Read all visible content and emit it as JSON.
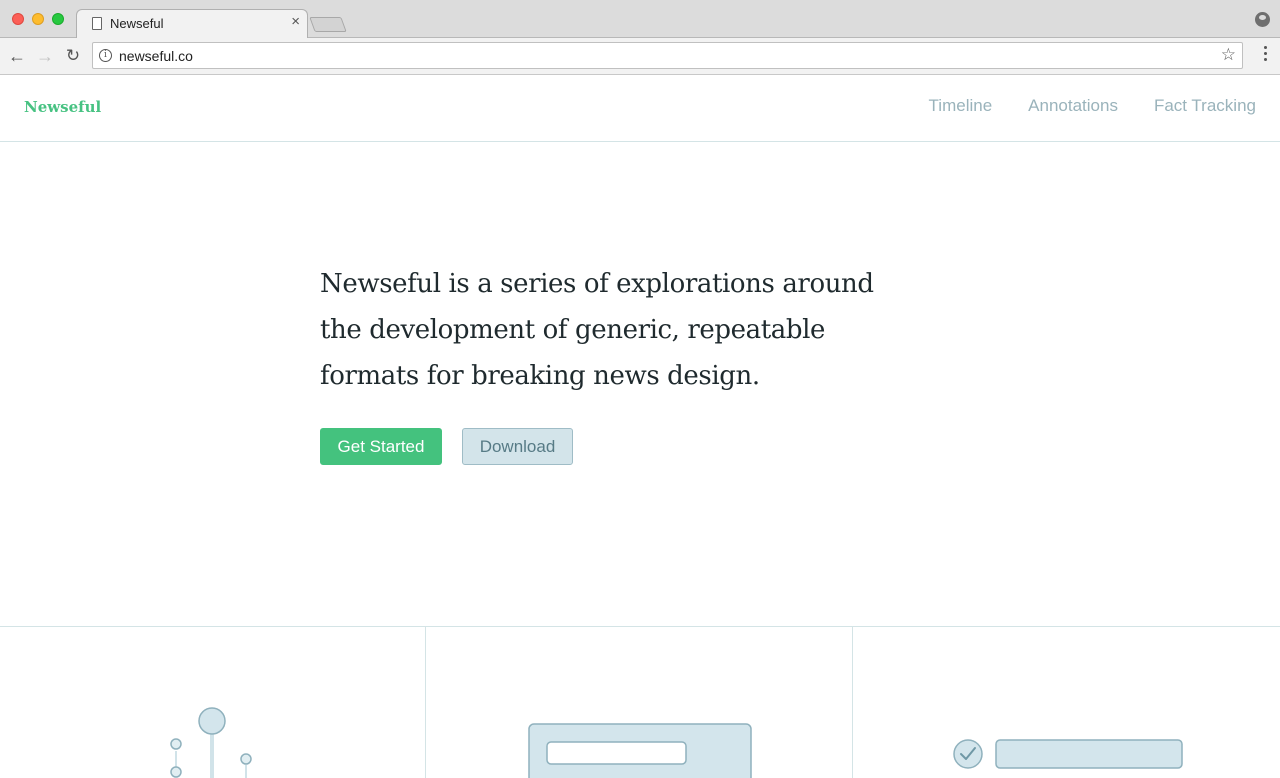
{
  "browser": {
    "tab_title": "Newseful",
    "tab_close": "×",
    "url": "newseful.co",
    "back_glyph": "←",
    "forward_glyph": "→",
    "reload_glyph": "↻",
    "info_glyph": "i",
    "star_glyph": "☆",
    "icons": [
      "page-icon",
      "close-icon",
      "profile-icon",
      "back-icon",
      "forward-icon",
      "reload-icon",
      "info-icon",
      "star-icon",
      "menu-icon"
    ]
  },
  "header": {
    "brand": "Newseful",
    "nav": [
      {
        "label": "Timeline"
      },
      {
        "label": "Annotations"
      },
      {
        "label": "Fact Tracking"
      }
    ]
  },
  "hero": {
    "text": "Newseful is a series of explorations around the development of generic, repeatable formats for breaking news design.",
    "primary_button": "Get Started",
    "secondary_button": "Download"
  },
  "features": [
    {
      "illustration": "timeline-illustration"
    },
    {
      "illustration": "annotation-illustration"
    },
    {
      "illustration": "fact-tracking-illustration"
    }
  ],
  "colors": {
    "brand_green": "#47c282",
    "nav_text": "#9ab3bb",
    "hero_text": "#1f2a2e",
    "secondary_fill": "#d3e4ea",
    "divider": "#d4e4e6"
  }
}
